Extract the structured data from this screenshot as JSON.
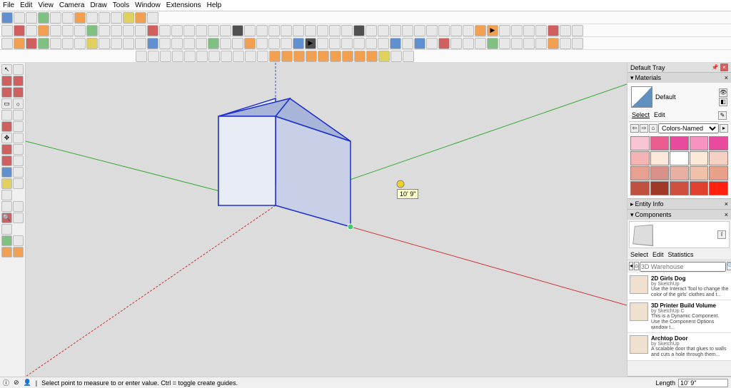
{
  "menu": {
    "items": [
      "File",
      "Edit",
      "View",
      "Camera",
      "Draw",
      "Tools",
      "Window",
      "Extensions",
      "Help"
    ]
  },
  "tray": {
    "title": "Default Tray",
    "materials": {
      "title": "Materials",
      "current_name": "Default",
      "tabs": {
        "select": "Select",
        "edit": "Edit"
      },
      "library": "Colors-Named",
      "colors": [
        "#f7c5d3",
        "#ea5b8f",
        "#e84a9e",
        "#f693c0",
        "#e84a9e",
        "#f4b4b4",
        "#fde8dc",
        "#ffffff",
        "#fce9d8",
        "#f7d0c4",
        "#e8a090",
        "#d89088",
        "#e8b0a0",
        "#f0c0a8",
        "#e8a088",
        "#c05040",
        "#a03828",
        "#d05040",
        "#e04030",
        "#ff2010"
      ]
    },
    "entity_info": {
      "title": "Entity Info"
    },
    "components": {
      "title": "Components",
      "tabs": {
        "select": "Select",
        "edit": "Edit",
        "stats": "Statistics"
      },
      "search_placeholder": "3D Warehouse",
      "items": [
        {
          "name": "2D Girls Dog",
          "author": "by SketchUp",
          "desc": "Use the Interact Tool to change the color of the girls' clothes and t..."
        },
        {
          "name": "3D Printer Build Volume",
          "author": "by SketchUp C",
          "desc": "This is a Dynamic Component. Use the Component Options window t..."
        },
        {
          "name": "Archtop Door",
          "author": "by SketchUp",
          "desc": "A scalable door that glues to walls and cuts a hole through them..."
        }
      ]
    }
  },
  "viewport": {
    "dimension_tooltip": "10' 9\""
  },
  "status": {
    "hint": "Select point to measure to or enter value. Ctrl = toggle create guides.",
    "length_label": "Length",
    "length_value": "10' 9\""
  }
}
